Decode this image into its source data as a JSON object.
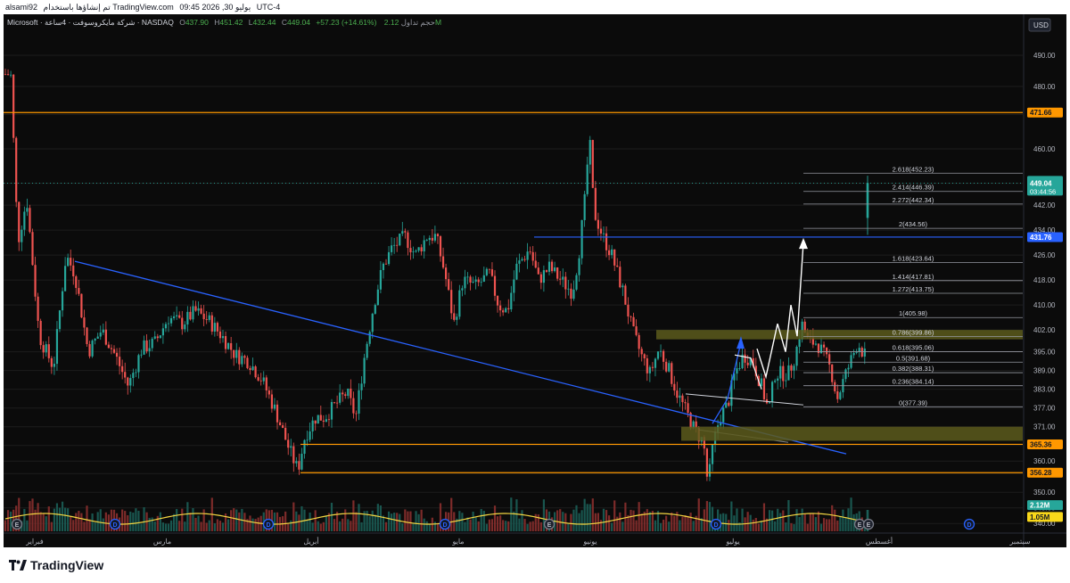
{
  "header": {
    "user": "alsami92",
    "published_prefix": "تم إنشاؤها باستخدام TradingView.com",
    "date": "يوليو 30, 2026 09:45",
    "tz": "UTC-4"
  },
  "legend": {
    "symbol": "Microsoft · شركة مايكروسوفت · 4ساعة · NASDAQ",
    "o_label": "O",
    "o": "437.90",
    "h_label": "H",
    "h": "451.42",
    "l_label": "L",
    "l": "432.44",
    "c_label": "C",
    "c": "449.04",
    "change": "+57.23 (+14.61%)",
    "vol_label": "حجم تداول",
    "vol": "2.12M"
  },
  "brand": {
    "name": "TradingView"
  },
  "colors": {
    "up": "#26a69a",
    "down": "#ef5350",
    "bg": "#0b0b0b",
    "grid": "#1c1c1c",
    "blue": "#2962ff",
    "orange": "#ff9800",
    "fib_zone": "#5c5a1c",
    "volume_ma": "#f5d742"
  },
  "chart_data": {
    "type": "candlestick",
    "currency": "USD",
    "y_ticks": [
      490,
      480,
      471,
      460,
      449,
      442,
      434,
      426,
      418,
      410,
      402,
      395,
      389,
      383,
      377,
      371,
      365,
      360,
      356,
      350,
      345,
      340
    ],
    "y_tick_labels": [
      "490.00",
      "480.00",
      "471.00",
      "460.00",
      "449.00",
      "442.00",
      "434.00",
      "426.00",
      "418.00",
      "410.00",
      "402.00",
      "395.00",
      "389.00",
      "383.00",
      "377.00",
      "371.00",
      "365.00",
      "360.00",
      "356.00",
      "350.00",
      "345.00",
      "340.00"
    ],
    "ylim": [
      337.5,
      498
    ],
    "x_labels": [
      "فبراير",
      "مارس",
      "أبريل",
      "مايو",
      "يونيو",
      "يوليو",
      "أغسطس",
      "سبتمبر"
    ],
    "price_tags": [
      {
        "label": "USD",
        "kind": "currency"
      },
      {
        "value": 471.66,
        "label": "471.66",
        "kind": "orange"
      },
      {
        "value": 449.04,
        "label": "449.04",
        "sub": "03:44:56",
        "kind": "last"
      },
      {
        "value": 431.76,
        "label": "431.76",
        "kind": "blue"
      },
      {
        "value": 365.36,
        "label": "365.36",
        "kind": "orange"
      },
      {
        "value": 356.28,
        "label": "356.28",
        "kind": "orange"
      },
      {
        "value": 345.9,
        "label": "2.12M",
        "kind": "volume"
      },
      {
        "value": 342.1,
        "label": "1.05M",
        "kind": "volume_ma"
      }
    ],
    "horizontal_lines": [
      {
        "value": 471.66,
        "color": "orange",
        "from": "left"
      },
      {
        "value": 431.76,
        "color": "blue",
        "from": "jun"
      },
      {
        "value": 365.36,
        "color": "orange",
        "from": "apr"
      },
      {
        "value": 356.28,
        "color": "orange",
        "from": "apr"
      }
    ],
    "fibonacci": {
      "levels": [
        {
          "ratio": "2.618",
          "value": 452.23
        },
        {
          "ratio": "2.414",
          "value": 446.39
        },
        {
          "ratio": "2.272",
          "value": 442.34
        },
        {
          "ratio": "2",
          "value": 434.56
        },
        {
          "ratio": "1.618",
          "value": 423.64
        },
        {
          "ratio": "1.414",
          "value": 417.81
        },
        {
          "ratio": "1.272",
          "value": 413.75
        },
        {
          "ratio": "1",
          "value": 405.98
        },
        {
          "ratio": "0.786",
          "value": 399.86
        },
        {
          "ratio": "0.618",
          "value": 395.06
        },
        {
          "ratio": "0.5",
          "value": 391.68
        },
        {
          "ratio": "0.382",
          "value": 388.31
        },
        {
          "ratio": "0.236",
          "value": 384.14
        },
        {
          "ratio": "0",
          "value": 377.39
        }
      ]
    },
    "zones": [
      {
        "from": 399.0,
        "to": 402.0
      },
      {
        "from": 366.5,
        "to": 371.0
      }
    ],
    "events": [
      "E",
      "D",
      "D",
      "D",
      "E",
      "D",
      "E",
      "E",
      "D"
    ],
    "volume_max": 2.12
  }
}
